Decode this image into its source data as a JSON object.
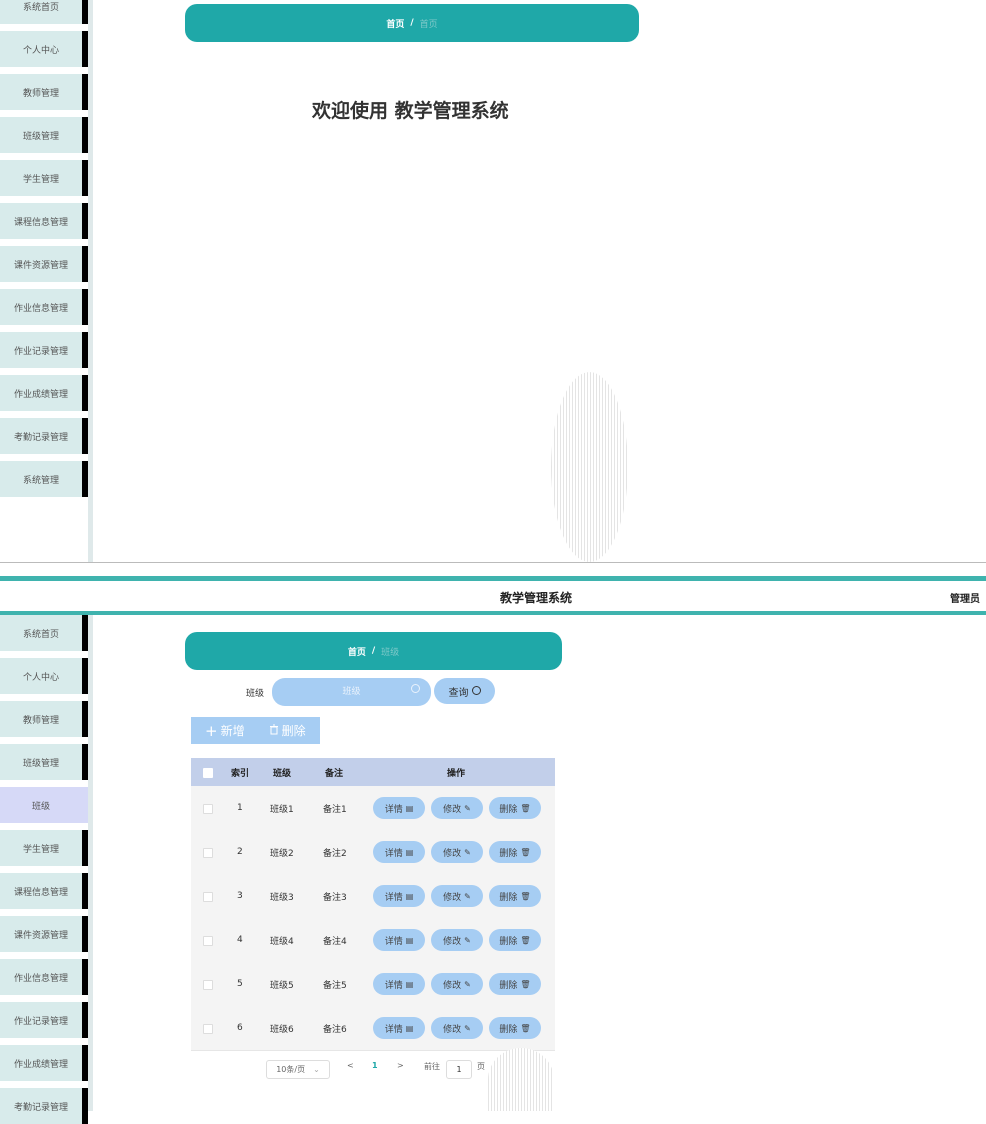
{
  "screen1": {
    "sidebar": [
      {
        "label": "系统首页"
      },
      {
        "label": "个人中心"
      },
      {
        "label": "教师管理"
      },
      {
        "label": "班级管理"
      },
      {
        "label": "学生管理"
      },
      {
        "label": "课程信息管理"
      },
      {
        "label": "课件资源管理"
      },
      {
        "label": "作业信息管理"
      },
      {
        "label": "作业记录管理"
      },
      {
        "label": "作业成绩管理"
      },
      {
        "label": "考勤记录管理"
      },
      {
        "label": "系统管理"
      }
    ],
    "breadcrumb": {
      "home": "首页",
      "separator": "/",
      "current": "首页"
    },
    "welcome": "欢迎使用 教学管理系统"
  },
  "screen2": {
    "header": {
      "title": "教学管理系统",
      "user": "管理员"
    },
    "sidebar": [
      {
        "label": "系统首页"
      },
      {
        "label": "个人中心"
      },
      {
        "label": "教师管理"
      },
      {
        "label": "班级管理"
      },
      {
        "label": "班级",
        "sub": true
      },
      {
        "label": "学生管理"
      },
      {
        "label": "课程信息管理"
      },
      {
        "label": "课件资源管理"
      },
      {
        "label": "作业信息管理"
      },
      {
        "label": "作业记录管理"
      },
      {
        "label": "作业成绩管理"
      },
      {
        "label": "考勤记录管理"
      }
    ],
    "breadcrumb": {
      "home": "首页",
      "separator": "/",
      "current": "班级"
    },
    "search": {
      "label": "班级",
      "placeholder": "班级",
      "button": "查询"
    },
    "actions": {
      "add": "新增",
      "delete": "删除"
    },
    "table": {
      "headers": {
        "index": "索引",
        "class": "班级",
        "remark": "备注",
        "ops": "操作"
      },
      "rows": [
        {
          "index": "1",
          "class": "班级1",
          "remark": "备注1"
        },
        {
          "index": "2",
          "class": "班级2",
          "remark": "备注2"
        },
        {
          "index": "3",
          "class": "班级3",
          "remark": "备注3"
        },
        {
          "index": "4",
          "class": "班级4",
          "remark": "备注4"
        },
        {
          "index": "5",
          "class": "班级5",
          "remark": "备注5"
        },
        {
          "index": "6",
          "class": "班级6",
          "remark": "备注6"
        }
      ],
      "row_buttons": {
        "detail": "详情",
        "edit": "修改",
        "remove": "删除"
      }
    },
    "pagination": {
      "page_size": "10条/页",
      "current_page": "1",
      "goto_label": "前往",
      "goto_value": "1",
      "page_unit": "页"
    }
  },
  "icons": {
    "plus": "plus-icon",
    "trash": "trash-icon",
    "search": "search-icon",
    "document": "document-icon",
    "pencil": "pencil-icon",
    "chevron": "chevron-icon"
  },
  "colors": {
    "teal": "#1fa8a8",
    "header_line": "#3fb3ae",
    "button_blue": "#a6cdf3",
    "table_head": "#c2cfea",
    "sidebar_bg": "#d8ebeb",
    "sidebar_sub": "#d6d9f7"
  }
}
